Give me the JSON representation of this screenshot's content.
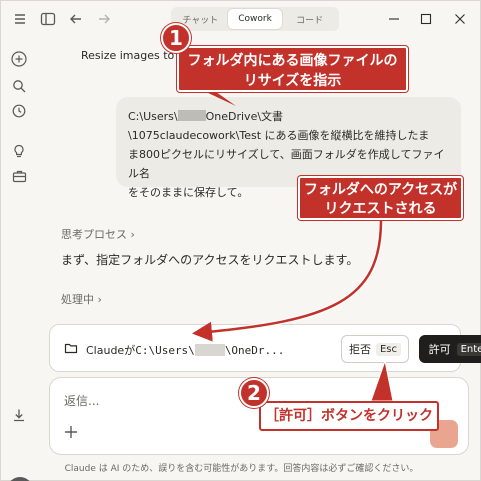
{
  "tabs": [
    {
      "label": "チャット",
      "active": false
    },
    {
      "label": "Cowork",
      "active": true
    },
    {
      "label": "コード",
      "active": false
    }
  ],
  "chat": {
    "title": "Resize images to c",
    "user_message": {
      "part1": "C:\\Users\\",
      "part2": "OneDrive\\文書",
      "line2": "\\1075claudecowork\\Test にある画像を縦横比を維持したま",
      "line3": "ま800ピクセルにリサイズして、画面フォルダを作成してファイル名",
      "line4": "をそのままに保存して。"
    },
    "thought_label": "思考プロセス",
    "response": "まず、指定フォルダへのアクセスをリクエストします。",
    "processing_label": "処理中"
  },
  "permission": {
    "prefix": "Claudeが",
    "path_start": "C:\\Users\\",
    "path_end": "\\OneDr...",
    "deny_label": "拒否",
    "deny_key": "Esc",
    "allow_label": "許可",
    "allow_key": "Enter"
  },
  "composer": {
    "placeholder": "返信..."
  },
  "disclaimer": "Claude は AI のため、誤りを含む可能性があります。回答内容は必ずご確認ください。",
  "annotations": {
    "callout1_line1": "フォルダ内にある画像ファイルの",
    "callout1_line2": "リサイズを指示",
    "callout2_line1": "フォルダへのアクセスが",
    "callout2_line2": "リクエストされる",
    "callout3": "［許可］ボタンをクリック",
    "badge1": "1",
    "badge2": "2"
  },
  "colors": {
    "annotation": "#c2322b",
    "background": "#f7f6f2",
    "allow_button": "#1f1e1c",
    "send_button": "#e9a58f"
  }
}
